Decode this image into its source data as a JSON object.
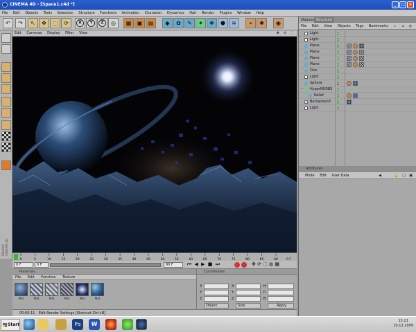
{
  "window": {
    "title": "CINEMA 4D - [Space1.c4d *]",
    "controls": [
      "_",
      "□",
      "×"
    ]
  },
  "menu": [
    "File",
    "Edit",
    "Objects",
    "Tools",
    "Selection",
    "Structure",
    "Functions",
    "Animation",
    "Character",
    "Dynamics",
    "Hair",
    "Render",
    "Plugins",
    "Window",
    "Help"
  ],
  "viewport": {
    "menu": [
      "Edit",
      "Cameras",
      "Display",
      "Filter",
      "View"
    ]
  },
  "timeline": {
    "ticks": [
      "0",
      "5",
      "10",
      "15",
      "20",
      "25",
      "30",
      "35",
      "40",
      "45",
      "50",
      "55",
      "60",
      "65",
      "70",
      "75",
      "80",
      "85",
      "90"
    ],
    "end_label": "0 F"
  },
  "transport": {
    "current": "0 F",
    "start": "0 F",
    "end": "90 F"
  },
  "materials": {
    "title": "Materials",
    "menu": [
      "File",
      "Edit",
      "Function",
      "Texture"
    ],
    "items": [
      "Mat",
      "Mat",
      "Mat",
      "Mat",
      "Mat",
      "Mat"
    ]
  },
  "coords": {
    "title": "Coordinates",
    "rows": [
      {
        "a": "X",
        "b": "X",
        "c": "H"
      },
      {
        "a": "Y",
        "b": "Y",
        "c": "P"
      },
      {
        "a": "Z",
        "b": "Z",
        "c": "B"
      }
    ],
    "object_select": "Object",
    "size_select": "Size",
    "apply": "Apply"
  },
  "status": {
    "time": "00:00:11",
    "text": "Edit Render Settings [Shortcut Ctrl+B]"
  },
  "objects_panel": {
    "tabs": [
      "Objects",
      "Structure"
    ],
    "menu": [
      "File",
      "Edit",
      "View",
      "Objects",
      "Tags",
      "Bookmarks"
    ],
    "rows": [
      {
        "name": "Light",
        "indent": 0
      },
      {
        "name": "Light",
        "indent": 0
      },
      {
        "name": "Plane",
        "indent": 0
      },
      {
        "name": "Plane",
        "indent": 0
      },
      {
        "name": "Plane",
        "indent": 0
      },
      {
        "name": "Plane",
        "indent": 0
      },
      {
        "name": "Disc",
        "indent": 0
      },
      {
        "name": "Light",
        "indent": 0
      },
      {
        "name": "Sphere",
        "indent": 0
      },
      {
        "name": "HyperNURBS",
        "indent": 0
      },
      {
        "name": "Relief",
        "indent": 1
      },
      {
        "name": "Background",
        "indent": 0
      },
      {
        "name": "Light",
        "indent": 0
      }
    ]
  },
  "attributes": {
    "title": "Attributes",
    "menu": [
      "Mode",
      "Edit",
      "User Data"
    ]
  },
  "taskbar": {
    "start": "Start",
    "time": "15:21",
    "date": "10.12.2009"
  },
  "side_brand": "MAXON CINEMA 4D"
}
